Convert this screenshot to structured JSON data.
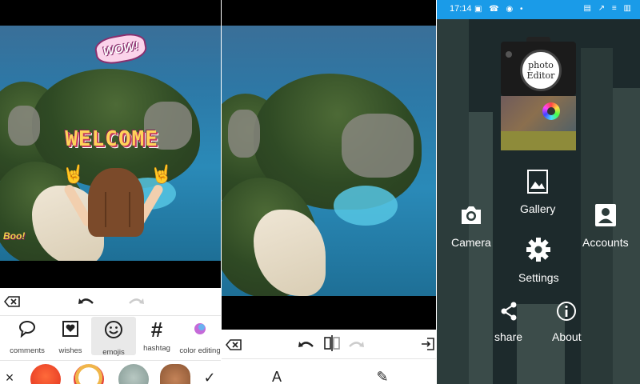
{
  "editor_panel": {
    "stickers": {
      "wow": "WOW!",
      "welcome": "WELCOME",
      "boo": "Boo!"
    },
    "toolbar": {
      "clear_icon": "backspace-icon",
      "undo_icon": "undo-icon",
      "redo_icon": "redo-icon"
    },
    "tools": [
      {
        "label": "comments",
        "icon": "comment-icon",
        "glyph": "🗨"
      },
      {
        "label": "wishes",
        "icon": "wishes-icon",
        "glyph": "♥"
      },
      {
        "label": "emojis",
        "icon": "emoji-icon",
        "glyph": "☺",
        "selected": true
      },
      {
        "label": "hashtag",
        "icon": "hashtag-icon",
        "glyph": "#"
      },
      {
        "label": "color editing",
        "icon": "color-icon",
        "glyph": "●"
      }
    ],
    "emoji_row": [
      "angry-emoji",
      "clown-emoji",
      "alien-emoji",
      "rocker-emoji"
    ],
    "close_glyph": "×",
    "check_glyph": "✓"
  },
  "crop_panel": {
    "toolbar_icons": [
      "backspace-icon",
      "undo-icon",
      "flip-icon",
      "redo-icon",
      "export-icon"
    ],
    "bottom_glyphs": [
      "A",
      "✎"
    ]
  },
  "home_panel": {
    "status": {
      "time": "17:14",
      "left_icons": "▣ ☎ ◉ •",
      "right_icons": "▤ ↗ ≡ ▥"
    },
    "logo_text": [
      "photo",
      "Editor"
    ],
    "menu": [
      {
        "label": "Gallery",
        "icon": "gallery-icon"
      },
      {
        "label": "Camera",
        "icon": "camera-icon"
      },
      {
        "label": "Accounts",
        "icon": "account-icon"
      },
      {
        "label": "Settings",
        "icon": "gear-icon"
      },
      {
        "label": "share",
        "icon": "share-icon"
      },
      {
        "label": "About",
        "icon": "info-icon"
      }
    ]
  }
}
